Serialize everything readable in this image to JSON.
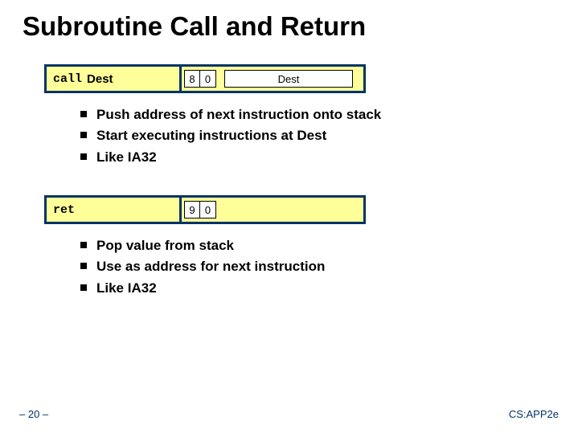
{
  "title": "Subroutine Call and Return",
  "call": {
    "mnemonic": "call",
    "operand": "Dest",
    "byte0": "8",
    "byte1": "0",
    "dest_label": "Dest",
    "bullets": [
      "Push address of next instruction onto stack",
      "Start executing instructions at Dest",
      "Like IA32"
    ]
  },
  "ret": {
    "mnemonic": "ret",
    "byte0": "9",
    "byte1": "0",
    "bullets": [
      "Pop value from stack",
      "Use as address for next instruction",
      "Like IA32"
    ]
  },
  "footer": {
    "page": "– 20 –",
    "right": "CS:APP2e"
  }
}
